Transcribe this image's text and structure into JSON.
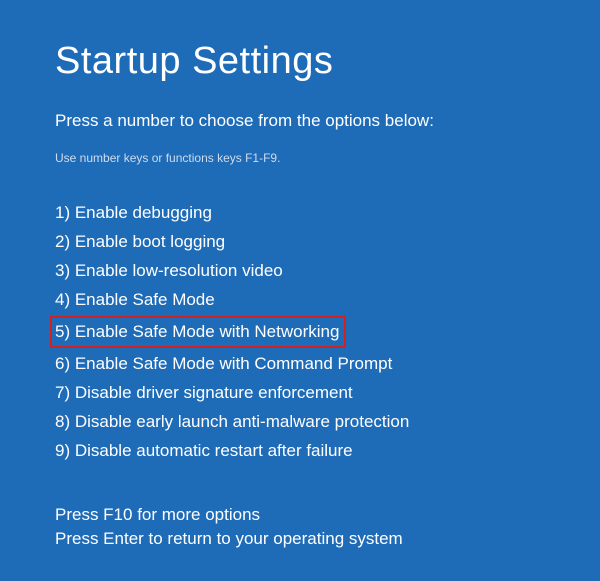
{
  "title": "Startup Settings",
  "subtitle": "Press a number to choose from the options below:",
  "hint": "Use number keys or functions keys F1-F9.",
  "options": [
    "1) Enable debugging",
    "2) Enable boot logging",
    "3) Enable low-resolution video",
    "4) Enable Safe Mode",
    "5) Enable Safe Mode with Networking",
    "6) Enable Safe Mode with Command Prompt",
    "7) Disable driver signature enforcement",
    "8) Disable early launch anti-malware protection",
    "9) Disable automatic restart after failure"
  ],
  "footer": {
    "more": "Press F10 for more options",
    "return": "Press Enter to return to your operating system"
  }
}
